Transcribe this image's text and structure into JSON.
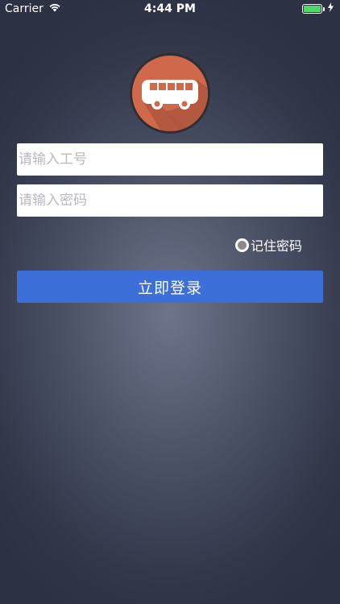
{
  "status_bar": {
    "carrier": "Carrier",
    "time": "4:44 PM",
    "battery_level": 1.0,
    "battery_color": "#4cd964",
    "wifi_icon": "wifi-icon",
    "charging_icon": "bolt-icon"
  },
  "logo": {
    "icon": "bus-icon",
    "circle_color": "#d0684c",
    "ring_color": "#2f2f33"
  },
  "form": {
    "employee_id_placeholder": "请输入工号",
    "employee_id_value": "",
    "password_placeholder": "请输入密码",
    "password_value": "",
    "remember_label": "记住密码",
    "remember_checked": false,
    "login_label": "立即登录",
    "login_color": "#3d6fd9"
  }
}
